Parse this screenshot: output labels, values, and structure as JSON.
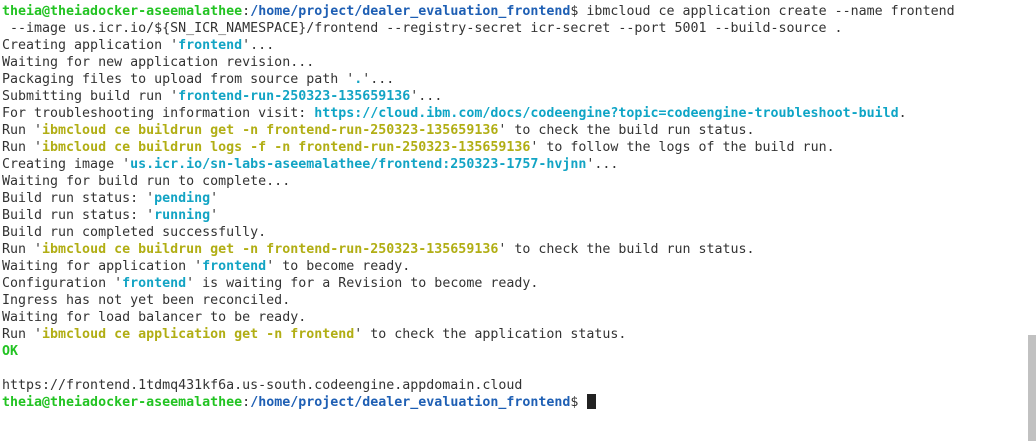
{
  "terminal": {
    "lines": [
      [
        {
          "t": "theia@theiadocker-aseemalathee",
          "c": "user"
        },
        {
          "t": ":",
          "c": "plain"
        },
        {
          "t": "/home/project/dealer_evaluation_frontend",
          "c": "path"
        },
        {
          "t": "$ ibmcloud ce application create --name frontend",
          "c": "plain"
        }
      ],
      [
        {
          "t": " --image us.icr.io/${SN_ICR_NAMESPACE}/frontend --registry-secret icr-secret --port 5001 --build-source .",
          "c": "plain"
        }
      ],
      [
        {
          "t": "Creating application '",
          "c": "plain"
        },
        {
          "t": "frontend",
          "c": "cyan"
        },
        {
          "t": "'...",
          "c": "plain"
        }
      ],
      [
        {
          "t": "Waiting for new application revision...",
          "c": "plain"
        }
      ],
      [
        {
          "t": "Packaging files to upload from source path '",
          "c": "plain"
        },
        {
          "t": ".",
          "c": "cyan"
        },
        {
          "t": "'...",
          "c": "plain"
        }
      ],
      [
        {
          "t": "Submitting build run '",
          "c": "plain"
        },
        {
          "t": "frontend-run-250323-135659136",
          "c": "cyan"
        },
        {
          "t": "'...",
          "c": "plain"
        }
      ],
      [
        {
          "t": "For troubleshooting information visit: ",
          "c": "plain"
        },
        {
          "t": "https://cloud.ibm.com/docs/codeengine?topic=codeengine-troubleshoot-build",
          "c": "link"
        },
        {
          "t": ".",
          "c": "plain"
        }
      ],
      [
        {
          "t": "Run '",
          "c": "plain"
        },
        {
          "t": "ibmcloud ce buildrun get -n frontend-run-250323-135659136",
          "c": "yellow"
        },
        {
          "t": "' to check the build run status.",
          "c": "plain"
        }
      ],
      [
        {
          "t": "Run '",
          "c": "plain"
        },
        {
          "t": "ibmcloud ce buildrun logs -f -n frontend-run-250323-135659136",
          "c": "yellow"
        },
        {
          "t": "' to follow the logs of the build run.",
          "c": "plain"
        }
      ],
      [
        {
          "t": "Creating image '",
          "c": "plain"
        },
        {
          "t": "us.icr.io/sn-labs-aseemalathee/frontend:250323-1757-hvjnn",
          "c": "cyan"
        },
        {
          "t": "'...",
          "c": "plain"
        }
      ],
      [
        {
          "t": "Waiting for build run to complete...",
          "c": "plain"
        }
      ],
      [
        {
          "t": "Build run status: '",
          "c": "plain"
        },
        {
          "t": "pending",
          "c": "cyan"
        },
        {
          "t": "'",
          "c": "plain"
        }
      ],
      [
        {
          "t": "Build run status: '",
          "c": "plain"
        },
        {
          "t": "running",
          "c": "cyan"
        },
        {
          "t": "'",
          "c": "plain"
        }
      ],
      [
        {
          "t": "Build run completed successfully.",
          "c": "plain"
        }
      ],
      [
        {
          "t": "Run '",
          "c": "plain"
        },
        {
          "t": "ibmcloud ce buildrun get -n frontend-run-250323-135659136",
          "c": "yellow"
        },
        {
          "t": "' to check the build run status.",
          "c": "plain"
        }
      ],
      [
        {
          "t": "Waiting for application '",
          "c": "plain"
        },
        {
          "t": "frontend",
          "c": "cyan"
        },
        {
          "t": "' to become ready.",
          "c": "plain"
        }
      ],
      [
        {
          "t": "Configuration '",
          "c": "plain"
        },
        {
          "t": "frontend",
          "c": "cyan"
        },
        {
          "t": "' is waiting for a Revision to become ready.",
          "c": "plain"
        }
      ],
      [
        {
          "t": "Ingress has not yet been reconciled.",
          "c": "plain"
        }
      ],
      [
        {
          "t": "Waiting for load balancer to be ready.",
          "c": "plain"
        }
      ],
      [
        {
          "t": "Run '",
          "c": "plain"
        },
        {
          "t": "ibmcloud ce application get -n frontend",
          "c": "yellow"
        },
        {
          "t": "' to check the application status.",
          "c": "plain"
        }
      ],
      [
        {
          "t": "OK",
          "c": "ok"
        }
      ],
      [],
      [
        {
          "t": "https://frontend.1tdmq431kf6a.us-south.codeengine.appdomain.cloud",
          "c": "plain"
        }
      ],
      [
        {
          "t": "theia@theiadocker-aseemalathee",
          "c": "user"
        },
        {
          "t": ":",
          "c": "plain"
        },
        {
          "t": "/home/project/dealer_evaluation_frontend",
          "c": "path"
        },
        {
          "t": "$ ",
          "c": "plain"
        },
        {
          "t": "",
          "c": "cursor"
        }
      ]
    ]
  },
  "colors": {
    "background": "#ffffff",
    "text": "#333333",
    "prompt_user": "#22c322",
    "prompt_path": "#1e5fb4",
    "highlight_cyan": "#13a4c4",
    "highlight_yellow": "#b1ae14",
    "scroll_thumb": "#c1c1c1"
  }
}
